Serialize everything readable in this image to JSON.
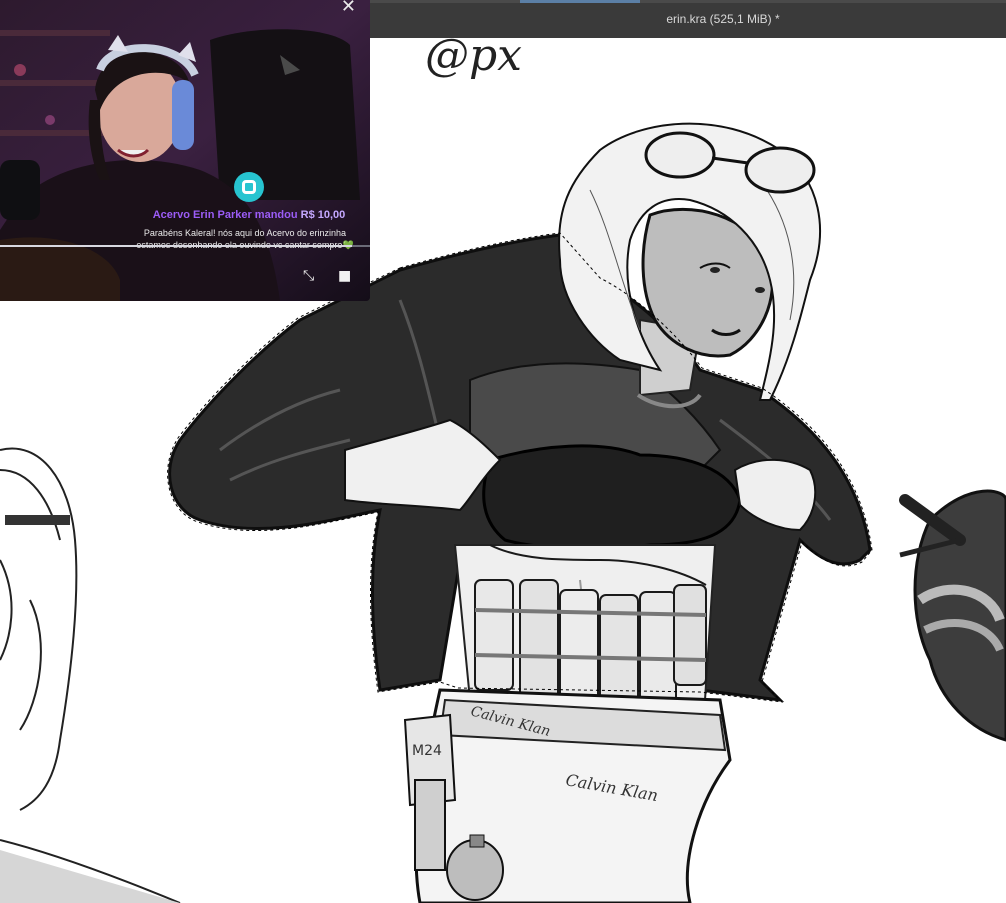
{
  "window": {
    "title": "erin.kra (525,1 MiB) *"
  },
  "canvas": {
    "sketch_text": "@px"
  },
  "stream_overlay": {
    "close_icon": "✕",
    "alert": {
      "icon": "livepix-icon",
      "title_prefix": "Acervo Erin Parker mandou ",
      "amount": "R$ 10,00",
      "message_line1": "Parabéns Kaleral! nós aqui do Acervo do erinzinha",
      "message_line2": "estamos desenhando ela ouvindo vc cantar sempre",
      "heart": "💚"
    },
    "progress": 0.95,
    "controls": {
      "pip_icon": "⤡",
      "stop_icon": "■"
    }
  },
  "colors": {
    "title_bar": "#3a3a3a",
    "alert_accent": "#9b5cf6",
    "icon_cyan": "#27c4d0"
  }
}
